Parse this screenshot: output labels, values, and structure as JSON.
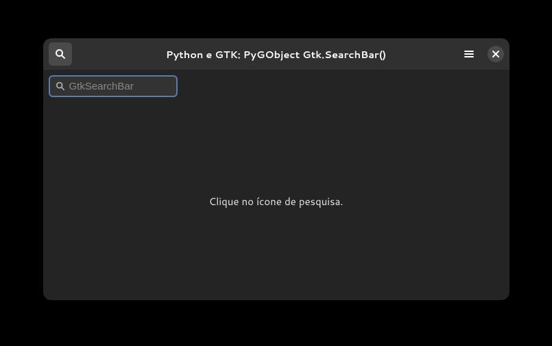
{
  "header": {
    "title": "Python e GTK: PyGObject Gtk.SearchBar()"
  },
  "search": {
    "placeholder": "GtkSearchBar",
    "value": ""
  },
  "content": {
    "message": "Clique no ícone de pesquisa."
  }
}
